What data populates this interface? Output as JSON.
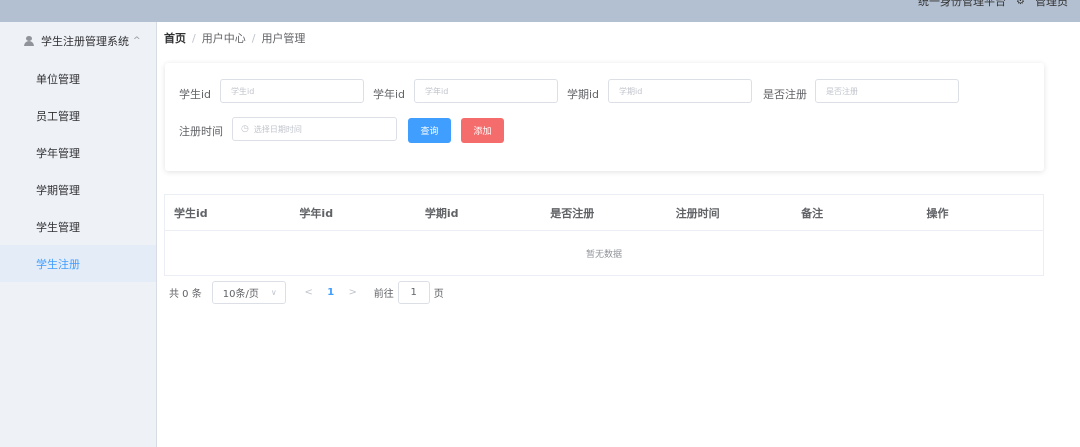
{
  "header": {
    "platform_name": "统一身份管理平台",
    "admin_label": "管理员",
    "gear_icon": "gear-icon"
  },
  "sidebar": {
    "title": "学生注册管理系统",
    "items": [
      {
        "label": "单位管理"
      },
      {
        "label": "员工管理"
      },
      {
        "label": "学年管理"
      },
      {
        "label": "学期管理"
      },
      {
        "label": "学生管理"
      },
      {
        "label": "学生注册"
      }
    ]
  },
  "breadcrumb": [
    "首页",
    "用户中心",
    "用户管理"
  ],
  "search": {
    "student_id_label": "学生id",
    "student_id_placeholder": "学生id",
    "year_id_label": "学年id",
    "year_id_placeholder": "学年id",
    "term_id_label": "学期id",
    "term_id_placeholder": "学期id",
    "registered_label": "是否注册",
    "registered_placeholder": "是否注册",
    "reg_time_label": "注册时间",
    "reg_time_placeholder": "选择日期时间",
    "query_button": "查询",
    "add_button": "添加"
  },
  "table": {
    "columns": [
      "学生id",
      "学年id",
      "学期id",
      "是否注册",
      "注册时间",
      "备注",
      "操作"
    ],
    "empty_text": "暂无数据"
  },
  "pagination": {
    "total": "共 0 条",
    "page_size": "10条/页",
    "prev": "<",
    "current_page": "1",
    "next": ">",
    "goto_label": "前往",
    "goto_value": "1",
    "goto_suffix": "页"
  },
  "colors": {
    "accent": "#409eff",
    "danger": "#f56c6c",
    "topbar": "#b3c0d1",
    "sidebar_bg": "#eef1f6"
  }
}
